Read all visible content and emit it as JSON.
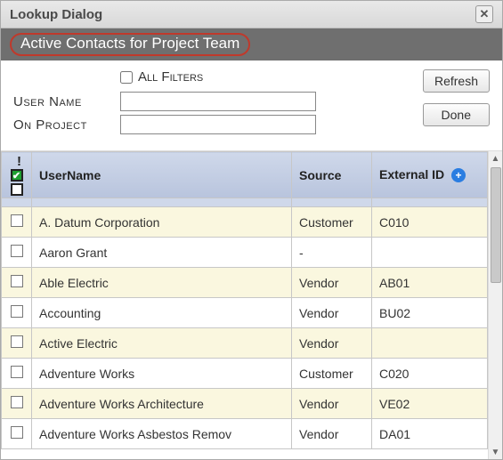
{
  "dialog": {
    "title": "Lookup Dialog",
    "subtitle": "Active Contacts for Project Team"
  },
  "filters": {
    "all_filters_label": "All Filters",
    "user_name_label": "User Name",
    "user_name_value": "",
    "on_project_label": "On Project",
    "on_project_value": ""
  },
  "buttons": {
    "refresh": "Refresh",
    "done": "Done"
  },
  "table": {
    "exclaim": "!",
    "headers": {
      "username": "UserName",
      "source": "Source",
      "external_id": "External ID"
    },
    "rows": [
      {
        "username": "A. Datum Corporation",
        "source": "Customer",
        "external_id": "C010"
      },
      {
        "username": "Aaron Grant",
        "source": "-",
        "external_id": ""
      },
      {
        "username": "Able Electric",
        "source": "Vendor",
        "external_id": "AB01"
      },
      {
        "username": "Accounting",
        "source": "Vendor",
        "external_id": "BU02"
      },
      {
        "username": "Active Electric",
        "source": "Vendor",
        "external_id": ""
      },
      {
        "username": "Adventure Works",
        "source": "Customer",
        "external_id": "C020"
      },
      {
        "username": "Adventure Works Architecture",
        "source": "Vendor",
        "external_id": "VE02"
      },
      {
        "username": "Adventure Works Asbestos Remov",
        "source": "Vendor",
        "external_id": "DA01"
      }
    ]
  }
}
